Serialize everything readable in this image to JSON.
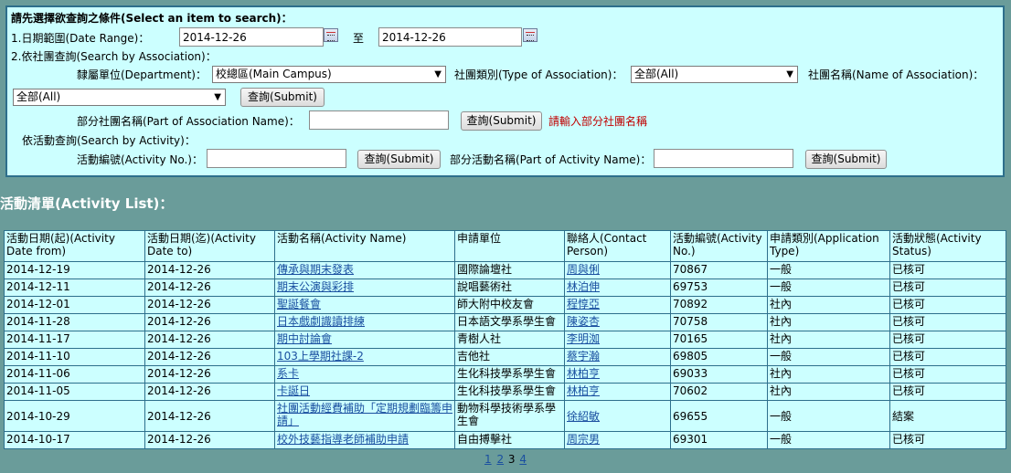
{
  "search": {
    "heading": "請先選擇欲查詢之條件(Select an item to search)：",
    "date_range_label": "1.日期範圍(Date Range)：",
    "date_from": "2014-12-26",
    "date_to_sep": "至",
    "date_to": "2014-12-26",
    "assoc_heading": "2.依社團查詢(Search by Association)：",
    "department_label": "隸屬單位(Department)：",
    "department_value": "校總區(Main Campus)",
    "assoc_type_label": "社團類別(Type of Association)：",
    "assoc_type_value": "全部(All)",
    "assoc_name_label": "社團名稱(Name of Association)：",
    "assoc_name_value": "全部(All)",
    "submit_label": "查詢(Submit)",
    "part_assoc_label": "部分社團名稱(Part of Association Name)：",
    "part_assoc_value": "",
    "part_assoc_hint": "請輸入部分社團名稱",
    "activity_heading": "依活動查詢(Search by Activity)：",
    "activity_no_label": "活動編號(Activity No.)：",
    "activity_no_value": "",
    "part_activity_label": "部分活動名稱(Part of Activity Name)：",
    "part_activity_value": ""
  },
  "list": {
    "title": "活動清單(Activity List)：",
    "headers": [
      "活動日期(起)(Activity Date from)",
      "活動日期(迄)(Activity Date to)",
      "活動名稱(Activity Name)",
      "申請單位",
      "聯絡人(Contact Person)",
      "活動編號(Activity No.)",
      "申請類別(Application Type)",
      "活動狀態(Activity Status)"
    ],
    "rows": [
      [
        "2014-12-19",
        "2014-12-26",
        "傳承與期末發表",
        "國際論壇社",
        "周與俐",
        "70867",
        "一般",
        "已核可"
      ],
      [
        "2014-12-11",
        "2014-12-26",
        "期末公演與彩排",
        "說唱藝術社",
        "林泊伸",
        "69753",
        "一般",
        "已核可"
      ],
      [
        "2014-12-01",
        "2014-12-26",
        "聖誕餐會",
        "師大附中校友會",
        "程惇亞",
        "70892",
        "社內",
        "已核可"
      ],
      [
        "2014-11-28",
        "2014-12-26",
        "日本戲劇識讀排練",
        "日本語文學系學生會",
        "陳姿杏",
        "70758",
        "社內",
        "已核可"
      ],
      [
        "2014-11-17",
        "2014-12-26",
        "期中討論會",
        "青樹人社",
        "李明洳",
        "70165",
        "社內",
        "已核可"
      ],
      [
        "2014-11-10",
        "2014-12-26",
        "103上學期社課-2",
        "吉他社",
        "蔡宇瀚",
        "69805",
        "一般",
        "已核可"
      ],
      [
        "2014-11-06",
        "2014-12-26",
        "系卡",
        "生化科技學系學生會",
        "林柏亨",
        "69033",
        "社內",
        "已核可"
      ],
      [
        "2014-11-05",
        "2014-12-26",
        "卡誕日",
        "生化科技學系學生會",
        "林柏亨",
        "70602",
        "社內",
        "已核可"
      ],
      [
        "2014-10-29",
        "2014-12-26",
        "社團活動經費補助「定期規劃臨籌申請」",
        "動物科學技術學系學生會",
        "徐紹敏",
        "69655",
        "一般",
        "結案"
      ],
      [
        "2014-10-17",
        "2014-12-26",
        "校外技藝指導老師補助申請",
        "自由搏擊社",
        "周宗男",
        "69301",
        "一般",
        "已核可"
      ]
    ]
  },
  "pager": {
    "pages": [
      "1",
      "2",
      "3",
      "4"
    ],
    "current": "3"
  }
}
